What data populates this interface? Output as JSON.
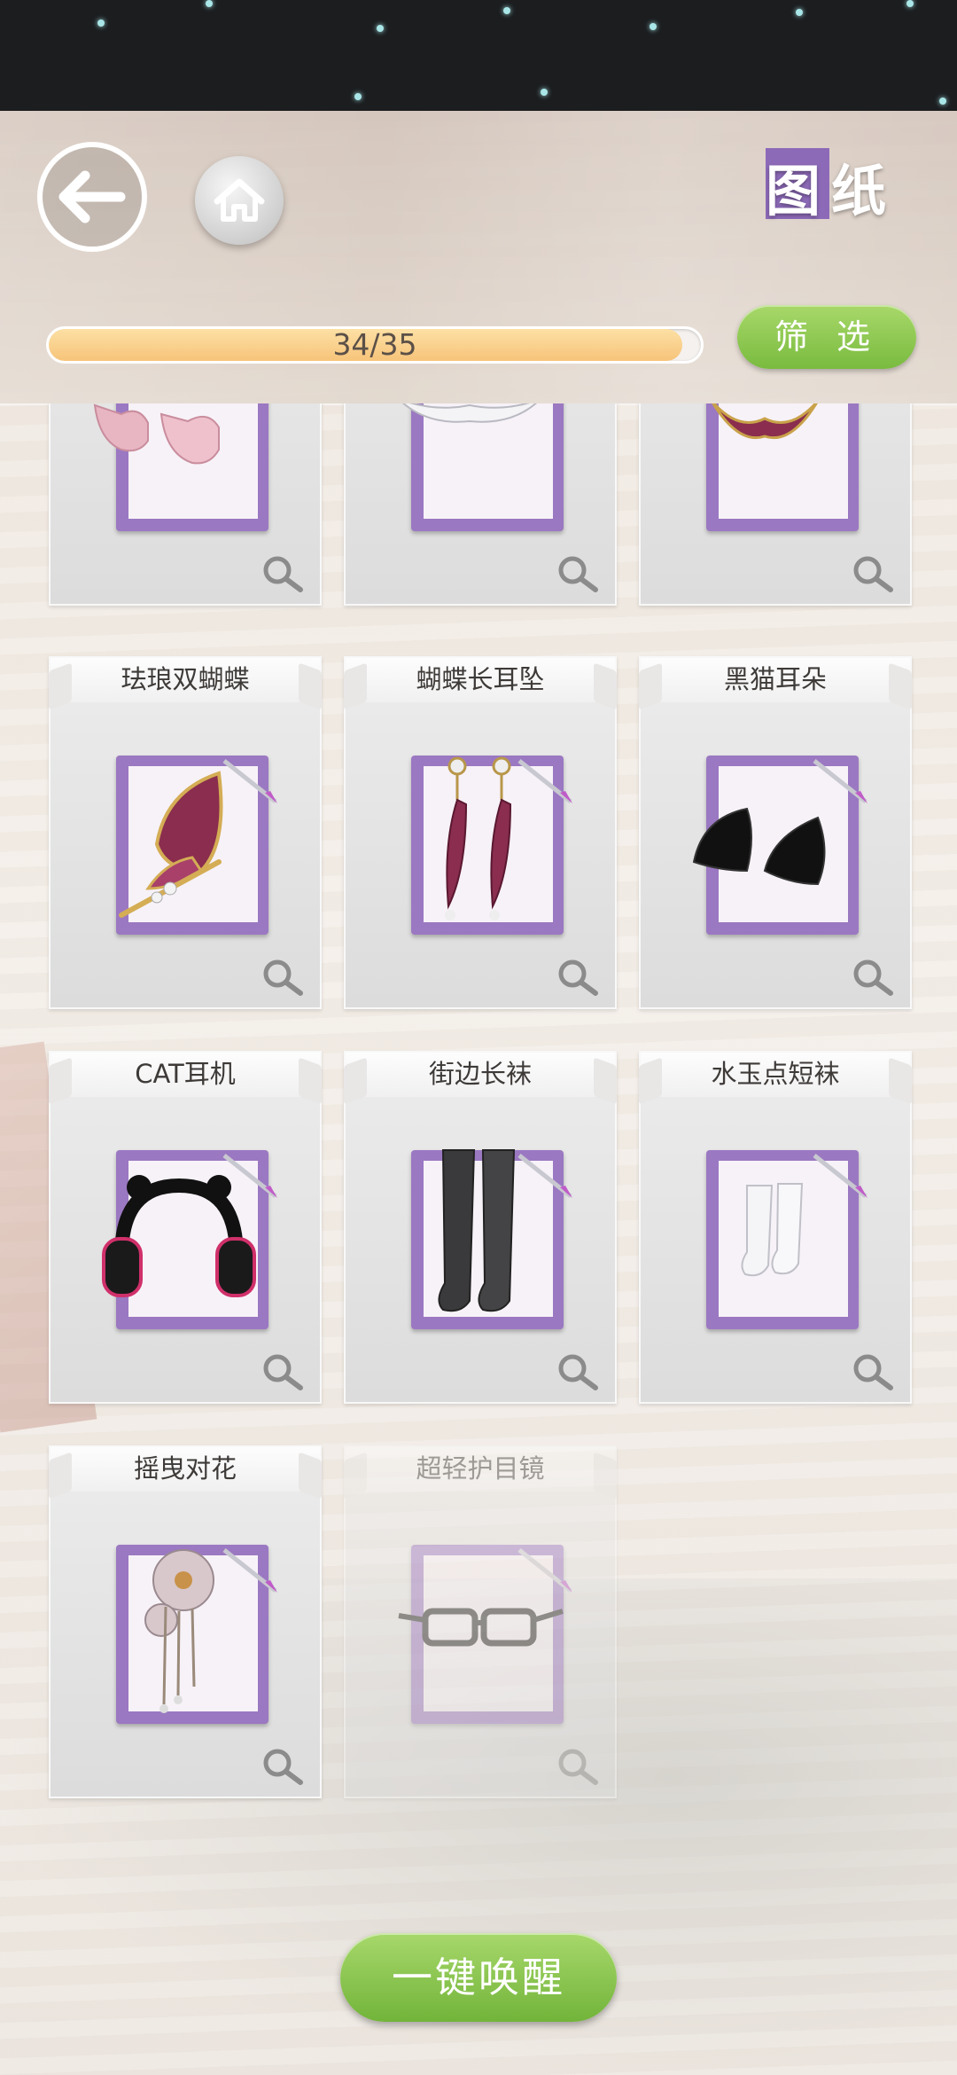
{
  "header": {
    "title": "图纸",
    "progress_text": "34/35",
    "progress_value": 0.971,
    "filter_label": "筛 选"
  },
  "icons": {
    "back": "back-arrow-icon",
    "home": "home-icon",
    "search": "magnifier-icon"
  },
  "colors": {
    "accent_purple": "#9b78c2",
    "button_green": "#79bb3f",
    "progress_fill": "#f7c47a"
  },
  "partial_row": [
    {
      "item": "pink-shoes"
    },
    {
      "item": "white-bow"
    },
    {
      "item": "butterfly-hairpin"
    }
  ],
  "cards": [
    {
      "name": "珐琅双蝴蝶",
      "item": "butterfly-hairpin",
      "locked": false
    },
    {
      "name": "蝴蝶长耳坠",
      "item": "feather-earrings",
      "locked": false
    },
    {
      "name": "黑猫耳朵",
      "item": "cat-ears",
      "locked": false
    },
    {
      "name": "CAT耳机",
      "item": "headphones",
      "locked": false
    },
    {
      "name": "街边长袜",
      "item": "long-socks",
      "locked": false
    },
    {
      "name": "水玉点短袜",
      "item": "dot-socks",
      "locked": false
    },
    {
      "name": "摇曳对花",
      "item": "flower-hairpin",
      "locked": false
    },
    {
      "name": "超轻护目镜",
      "item": "glasses",
      "locked": true
    }
  ],
  "footer": {
    "awaken_label": "一键唤醒"
  }
}
